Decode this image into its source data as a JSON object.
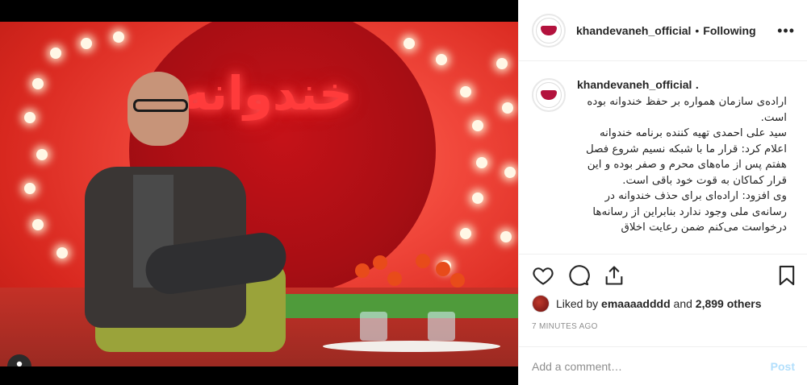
{
  "post": {
    "image_alt_text": "",
    "owner_icon": "person-icon"
  },
  "header": {
    "username": "khandevaneh_official",
    "separator": "•",
    "follow_status": "Following",
    "more_icon": "more-horizontal-icon",
    "more_label": "•••"
  },
  "caption": {
    "username": "khandevaneh_official",
    "username_suffix": ".",
    "text": "اراده‌ی سازمان همواره بر حفظ خندوانه بوده است.\nسید علی احمدی تهیه کننده برنامه خندوانه اعلام کرد: قرار ما با شبکه نسیم شروع فصل هفتم پس از ماه‌های محرم و صفر بوده و این قرار کماکان به قوت خود باقی است.\nوی افزود: اراده‌ای برای حذف خندوانه در رسانه‌ی ملی وجود ندارد بنابراین از رسانه‌ها درخواست می‌کنم ضمن رعایت اخلاق"
  },
  "actions": {
    "like_icon": "heart-icon",
    "comment_icon": "comment-icon",
    "share_icon": "share-icon",
    "save_icon": "bookmark-icon"
  },
  "likes": {
    "prefix": "Liked by",
    "user": "emaaaadddd",
    "and": "and",
    "others": "2,899 others"
  },
  "timestamp": "7 MINUTES AGO",
  "comment": {
    "placeholder": "Add a comment…",
    "post_label": "Post"
  },
  "colors": {
    "brand_lip": "#b3123d",
    "post_disabled": "#b2dffc",
    "muted": "#8e8e8e",
    "text": "#262626"
  }
}
